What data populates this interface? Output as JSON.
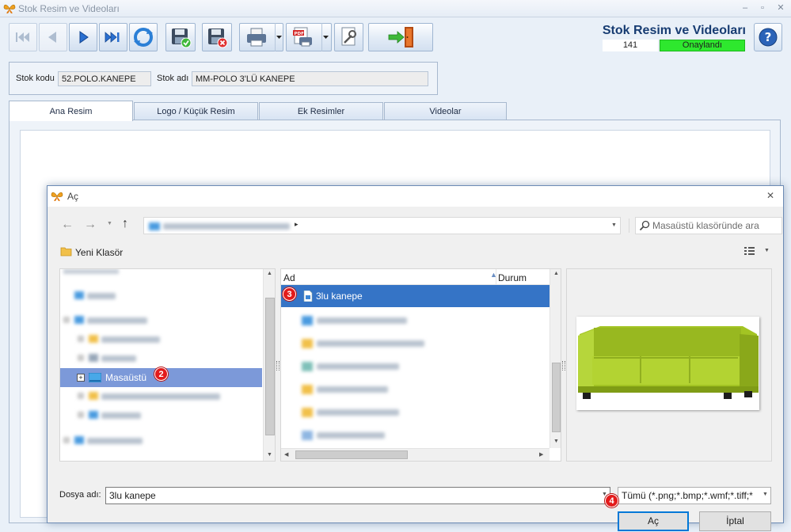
{
  "window": {
    "title": "Stok Resim ve Videoları",
    "minimize_label": "–",
    "maximize_label": "▫",
    "close_label": "✕"
  },
  "toolbar": {
    "buttons": [
      {
        "icon": "first-record-icon",
        "enabled": false
      },
      {
        "icon": "previous-record-icon",
        "enabled": false
      },
      {
        "icon": "next-record-icon",
        "enabled": true
      },
      {
        "icon": "last-record-icon",
        "enabled": true
      },
      {
        "icon": "refresh-icon",
        "enabled": true
      },
      {
        "icon": "save-approve-icon",
        "enabled": true
      },
      {
        "icon": "save-cancel-icon",
        "enabled": true
      },
      {
        "icon": "print-icon",
        "enabled": true
      },
      {
        "icon": "pdf-export-icon",
        "enabled": true
      },
      {
        "icon": "tools-icon",
        "enabled": true
      },
      {
        "icon": "exit-icon",
        "enabled": true
      }
    ]
  },
  "header": {
    "title": "Stok Resim ve Videoları",
    "record_number": "141",
    "status": "Onaylandı",
    "status_color": "#2ee82e"
  },
  "stock": {
    "code_label": "Stok kodu",
    "code_value": "52.POLO.KANEPE",
    "name_label": "Stok adı",
    "name_value": "MM-POLO 3'LÜ KANEPE"
  },
  "tabs": [
    {
      "label": "Ana Resim",
      "active": true
    },
    {
      "label": "Logo / Küçük Resim",
      "active": false
    },
    {
      "label": "Ek Resimler",
      "active": false
    },
    {
      "label": "Videolar",
      "active": false
    }
  ],
  "dialog": {
    "title": "Aç",
    "close_label": "✕",
    "search_placeholder": "Masaüstü klasöründe ara",
    "new_folder_label": "Yeni Klasör",
    "tree": {
      "selected_item": "Masaüstü",
      "expand_glyph": "+"
    },
    "list": {
      "columns": [
        "Ad",
        "Durum"
      ],
      "selected_file": "3lu kanepe"
    },
    "filename_label": "Dosya adı:",
    "filename_value": "3lu kanepe",
    "filter_value": "Tümü (*.png;*.bmp;*.wmf;*.tiff;*",
    "open_label": "Aç",
    "cancel_label": "İptal"
  },
  "annotations": [
    "2",
    "3",
    "4"
  ],
  "colors": {
    "accent": "#3a79c9",
    "selection": "#3574c6",
    "status_green": "#2ee82e",
    "step_marker": "#e31b1b"
  }
}
